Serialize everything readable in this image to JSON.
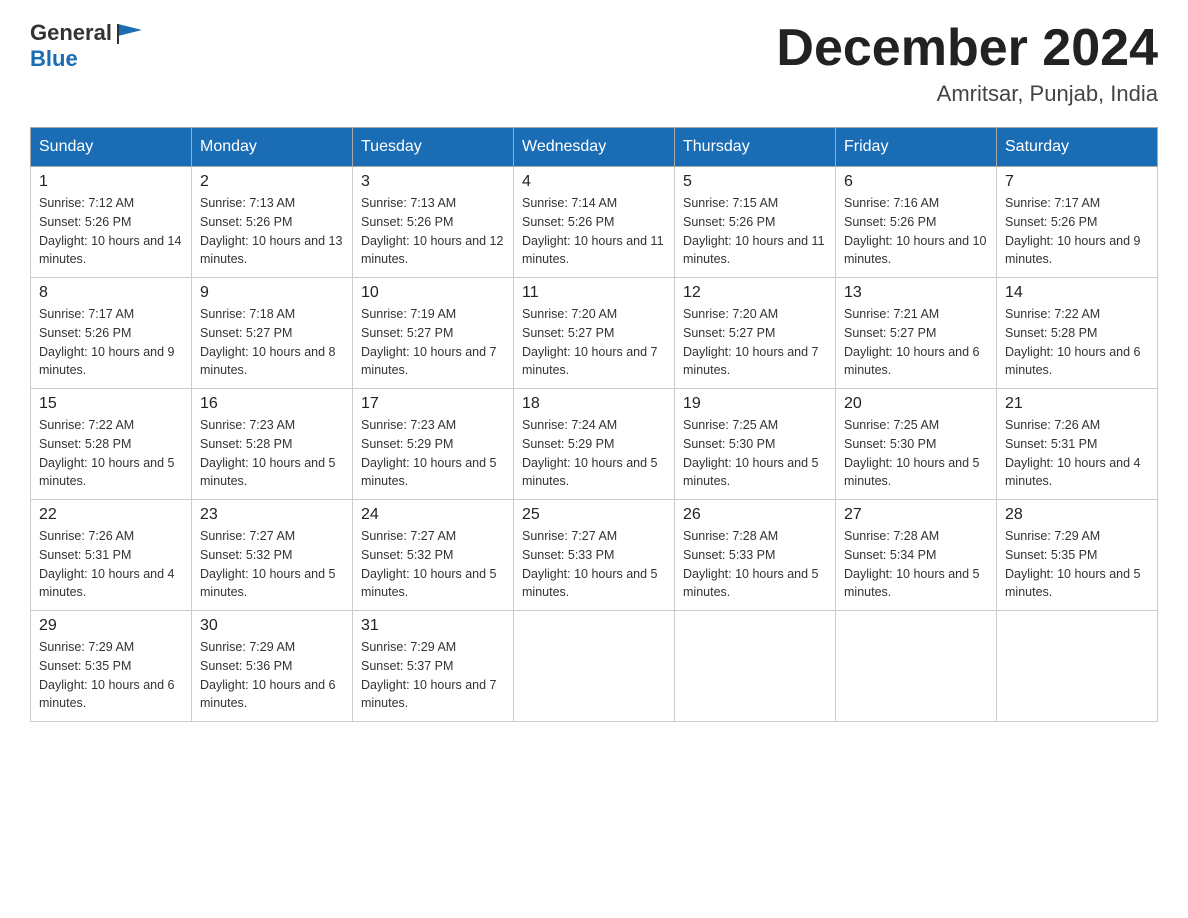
{
  "header": {
    "logo_general": "General",
    "logo_blue": "Blue",
    "month_title": "December 2024",
    "location": "Amritsar, Punjab, India"
  },
  "days_of_week": [
    "Sunday",
    "Monday",
    "Tuesday",
    "Wednesday",
    "Thursday",
    "Friday",
    "Saturday"
  ],
  "weeks": [
    [
      {
        "day": "1",
        "sunrise": "7:12 AM",
        "sunset": "5:26 PM",
        "daylight": "10 hours and 14 minutes."
      },
      {
        "day": "2",
        "sunrise": "7:13 AM",
        "sunset": "5:26 PM",
        "daylight": "10 hours and 13 minutes."
      },
      {
        "day": "3",
        "sunrise": "7:13 AM",
        "sunset": "5:26 PM",
        "daylight": "10 hours and 12 minutes."
      },
      {
        "day": "4",
        "sunrise": "7:14 AM",
        "sunset": "5:26 PM",
        "daylight": "10 hours and 11 minutes."
      },
      {
        "day": "5",
        "sunrise": "7:15 AM",
        "sunset": "5:26 PM",
        "daylight": "10 hours and 11 minutes."
      },
      {
        "day": "6",
        "sunrise": "7:16 AM",
        "sunset": "5:26 PM",
        "daylight": "10 hours and 10 minutes."
      },
      {
        "day": "7",
        "sunrise": "7:17 AM",
        "sunset": "5:26 PM",
        "daylight": "10 hours and 9 minutes."
      }
    ],
    [
      {
        "day": "8",
        "sunrise": "7:17 AM",
        "sunset": "5:26 PM",
        "daylight": "10 hours and 9 minutes."
      },
      {
        "day": "9",
        "sunrise": "7:18 AM",
        "sunset": "5:27 PM",
        "daylight": "10 hours and 8 minutes."
      },
      {
        "day": "10",
        "sunrise": "7:19 AM",
        "sunset": "5:27 PM",
        "daylight": "10 hours and 7 minutes."
      },
      {
        "day": "11",
        "sunrise": "7:20 AM",
        "sunset": "5:27 PM",
        "daylight": "10 hours and 7 minutes."
      },
      {
        "day": "12",
        "sunrise": "7:20 AM",
        "sunset": "5:27 PM",
        "daylight": "10 hours and 7 minutes."
      },
      {
        "day": "13",
        "sunrise": "7:21 AM",
        "sunset": "5:27 PM",
        "daylight": "10 hours and 6 minutes."
      },
      {
        "day": "14",
        "sunrise": "7:22 AM",
        "sunset": "5:28 PM",
        "daylight": "10 hours and 6 minutes."
      }
    ],
    [
      {
        "day": "15",
        "sunrise": "7:22 AM",
        "sunset": "5:28 PM",
        "daylight": "10 hours and 5 minutes."
      },
      {
        "day": "16",
        "sunrise": "7:23 AM",
        "sunset": "5:28 PM",
        "daylight": "10 hours and 5 minutes."
      },
      {
        "day": "17",
        "sunrise": "7:23 AM",
        "sunset": "5:29 PM",
        "daylight": "10 hours and 5 minutes."
      },
      {
        "day": "18",
        "sunrise": "7:24 AM",
        "sunset": "5:29 PM",
        "daylight": "10 hours and 5 minutes."
      },
      {
        "day": "19",
        "sunrise": "7:25 AM",
        "sunset": "5:30 PM",
        "daylight": "10 hours and 5 minutes."
      },
      {
        "day": "20",
        "sunrise": "7:25 AM",
        "sunset": "5:30 PM",
        "daylight": "10 hours and 5 minutes."
      },
      {
        "day": "21",
        "sunrise": "7:26 AM",
        "sunset": "5:31 PM",
        "daylight": "10 hours and 4 minutes."
      }
    ],
    [
      {
        "day": "22",
        "sunrise": "7:26 AM",
        "sunset": "5:31 PM",
        "daylight": "10 hours and 4 minutes."
      },
      {
        "day": "23",
        "sunrise": "7:27 AM",
        "sunset": "5:32 PM",
        "daylight": "10 hours and 5 minutes."
      },
      {
        "day": "24",
        "sunrise": "7:27 AM",
        "sunset": "5:32 PM",
        "daylight": "10 hours and 5 minutes."
      },
      {
        "day": "25",
        "sunrise": "7:27 AM",
        "sunset": "5:33 PM",
        "daylight": "10 hours and 5 minutes."
      },
      {
        "day": "26",
        "sunrise": "7:28 AM",
        "sunset": "5:33 PM",
        "daylight": "10 hours and 5 minutes."
      },
      {
        "day": "27",
        "sunrise": "7:28 AM",
        "sunset": "5:34 PM",
        "daylight": "10 hours and 5 minutes."
      },
      {
        "day": "28",
        "sunrise": "7:29 AM",
        "sunset": "5:35 PM",
        "daylight": "10 hours and 5 minutes."
      }
    ],
    [
      {
        "day": "29",
        "sunrise": "7:29 AM",
        "sunset": "5:35 PM",
        "daylight": "10 hours and 6 minutes."
      },
      {
        "day": "30",
        "sunrise": "7:29 AM",
        "sunset": "5:36 PM",
        "daylight": "10 hours and 6 minutes."
      },
      {
        "day": "31",
        "sunrise": "7:29 AM",
        "sunset": "5:37 PM",
        "daylight": "10 hours and 7 minutes."
      },
      null,
      null,
      null,
      null
    ]
  ],
  "colors": {
    "header_bg": "#1a6db5",
    "header_text": "#ffffff",
    "border": "#aaaaaa",
    "row_divider": "#1a6db5"
  },
  "labels": {
    "sunrise_prefix": "Sunrise: ",
    "sunset_prefix": "Sunset: ",
    "daylight_prefix": "Daylight: "
  }
}
